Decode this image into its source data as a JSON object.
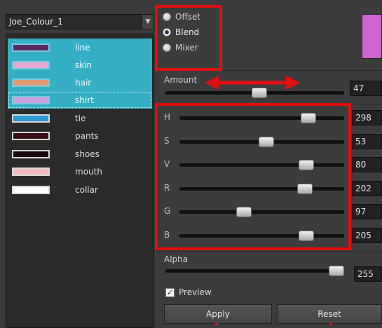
{
  "palette": {
    "name": "Joe_Colour_1",
    "colors": [
      {
        "name": "line",
        "swatch": "#5b2a5d",
        "selected": true,
        "focused": false
      },
      {
        "name": "skin",
        "swatch": "#e3a8d3",
        "selected": true,
        "focused": false
      },
      {
        "name": "hair",
        "swatch": "#e39a6e",
        "selected": true,
        "focused": false
      },
      {
        "name": "shirt",
        "swatch": "#ca9fdd",
        "selected": true,
        "focused": true
      },
      {
        "name": "tie",
        "swatch": "#2f99d7",
        "selected": false,
        "focused": false
      },
      {
        "name": "pants",
        "swatch": "#3b0c14",
        "selected": false,
        "focused": false
      },
      {
        "name": "shoes",
        "swatch": "#150808",
        "selected": false,
        "focused": false
      },
      {
        "name": "mouth",
        "swatch": "#f6b8c3",
        "selected": false,
        "focused": false
      },
      {
        "name": "collar",
        "swatch": "#ffffff",
        "selected": false,
        "focused": false
      }
    ]
  },
  "mode": {
    "options": [
      "Offset",
      "Blend",
      "Mixer"
    ],
    "selected": "Blend"
  },
  "amount": {
    "label": "Amount",
    "value": "47",
    "fraction": 0.53
  },
  "channels": [
    {
      "label": "H",
      "value": "298",
      "fraction": 0.81
    },
    {
      "label": "S",
      "value": "53",
      "fraction": 0.53
    },
    {
      "label": "V",
      "value": "80",
      "fraction": 0.8
    },
    {
      "label": "R",
      "value": "202",
      "fraction": 0.79
    },
    {
      "label": "G",
      "value": "97",
      "fraction": 0.38
    },
    {
      "label": "B",
      "value": "205",
      "fraction": 0.8
    }
  ],
  "alpha": {
    "label": "Alpha",
    "value": "255",
    "fraction": 1.0
  },
  "preview": {
    "label": "Preview",
    "checked": true,
    "check_glyph": "✓"
  },
  "preview_color": "#ca66cd",
  "buttons": {
    "apply": "Apply",
    "reset": "Reset"
  },
  "dropdown_glyph": "▼",
  "annotation_color": "#e20f0f"
}
